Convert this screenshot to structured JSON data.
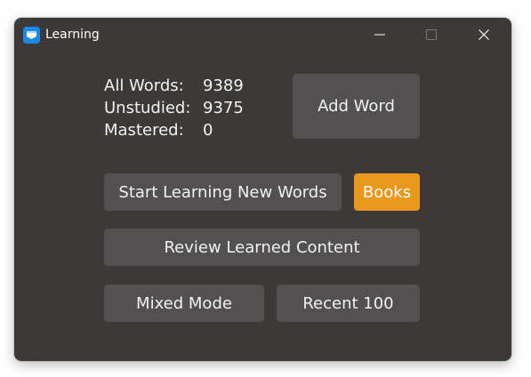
{
  "window": {
    "title": "Learning",
    "icon": "app-book-icon",
    "controls": [
      "minimize-icon",
      "maximize-icon",
      "close-icon"
    ]
  },
  "stats": {
    "all_words": {
      "label": "All Words:",
      "value": "9389"
    },
    "unstudied": {
      "label": "Unstudied:",
      "value": "9375"
    },
    "mastered": {
      "label": "Mastered:",
      "value": "0"
    }
  },
  "buttons": {
    "add_word": "Add Word",
    "start_learning": "Start Learning New Words",
    "books": "Books",
    "review": "Review Learned Content",
    "mixed_mode": "Mixed Mode",
    "recent": "Recent 100"
  },
  "colors": {
    "background": "#3c3a39",
    "button": "#525050",
    "accent": "#e9981b",
    "text": "#f2f2f2",
    "app_icon": "#1a8ae6"
  }
}
